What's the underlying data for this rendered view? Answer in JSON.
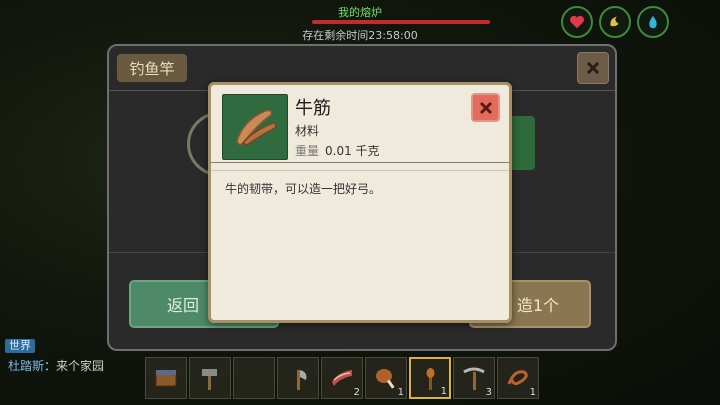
{
  "hud": {
    "title": "我的熔炉",
    "timer": "存在剩余时间23:58:00",
    "health_fraction": 1.0
  },
  "status_icons": [
    "heart-icon",
    "hunger-icon",
    "water-drop-icon"
  ],
  "panel": {
    "tab_label": "钓鱼竿",
    "back_button": "返回",
    "craft_button": "造1个"
  },
  "tooltip": {
    "name": "牛筋",
    "category": "材料",
    "weight_label": "重量",
    "weight_value": "0.01 千克",
    "description": "牛的韧带，可以造一把好弓。",
    "icon": "sinew-icon"
  },
  "chat": {
    "channel": "世界",
    "sender": "杜踏斯",
    "message": "来个家园"
  },
  "hotbar": [
    {
      "icon": "chest-item-icon",
      "count": ""
    },
    {
      "icon": "hammer-icon",
      "count": ""
    },
    {
      "icon": "empty-slot",
      "count": ""
    },
    {
      "icon": "axe-icon",
      "count": ""
    },
    {
      "icon": "bacon-icon",
      "count": "2"
    },
    {
      "icon": "drumstick-icon",
      "count": "1"
    },
    {
      "icon": "torch-icon",
      "count": "1",
      "selected": true
    },
    {
      "icon": "pickaxe-icon",
      "count": "3"
    },
    {
      "icon": "rope-icon",
      "count": "1"
    }
  ],
  "colors": {
    "tooltip_bg": "#efeadb",
    "close_red": "#e46a5c",
    "hud_green": "#6fe26a"
  }
}
